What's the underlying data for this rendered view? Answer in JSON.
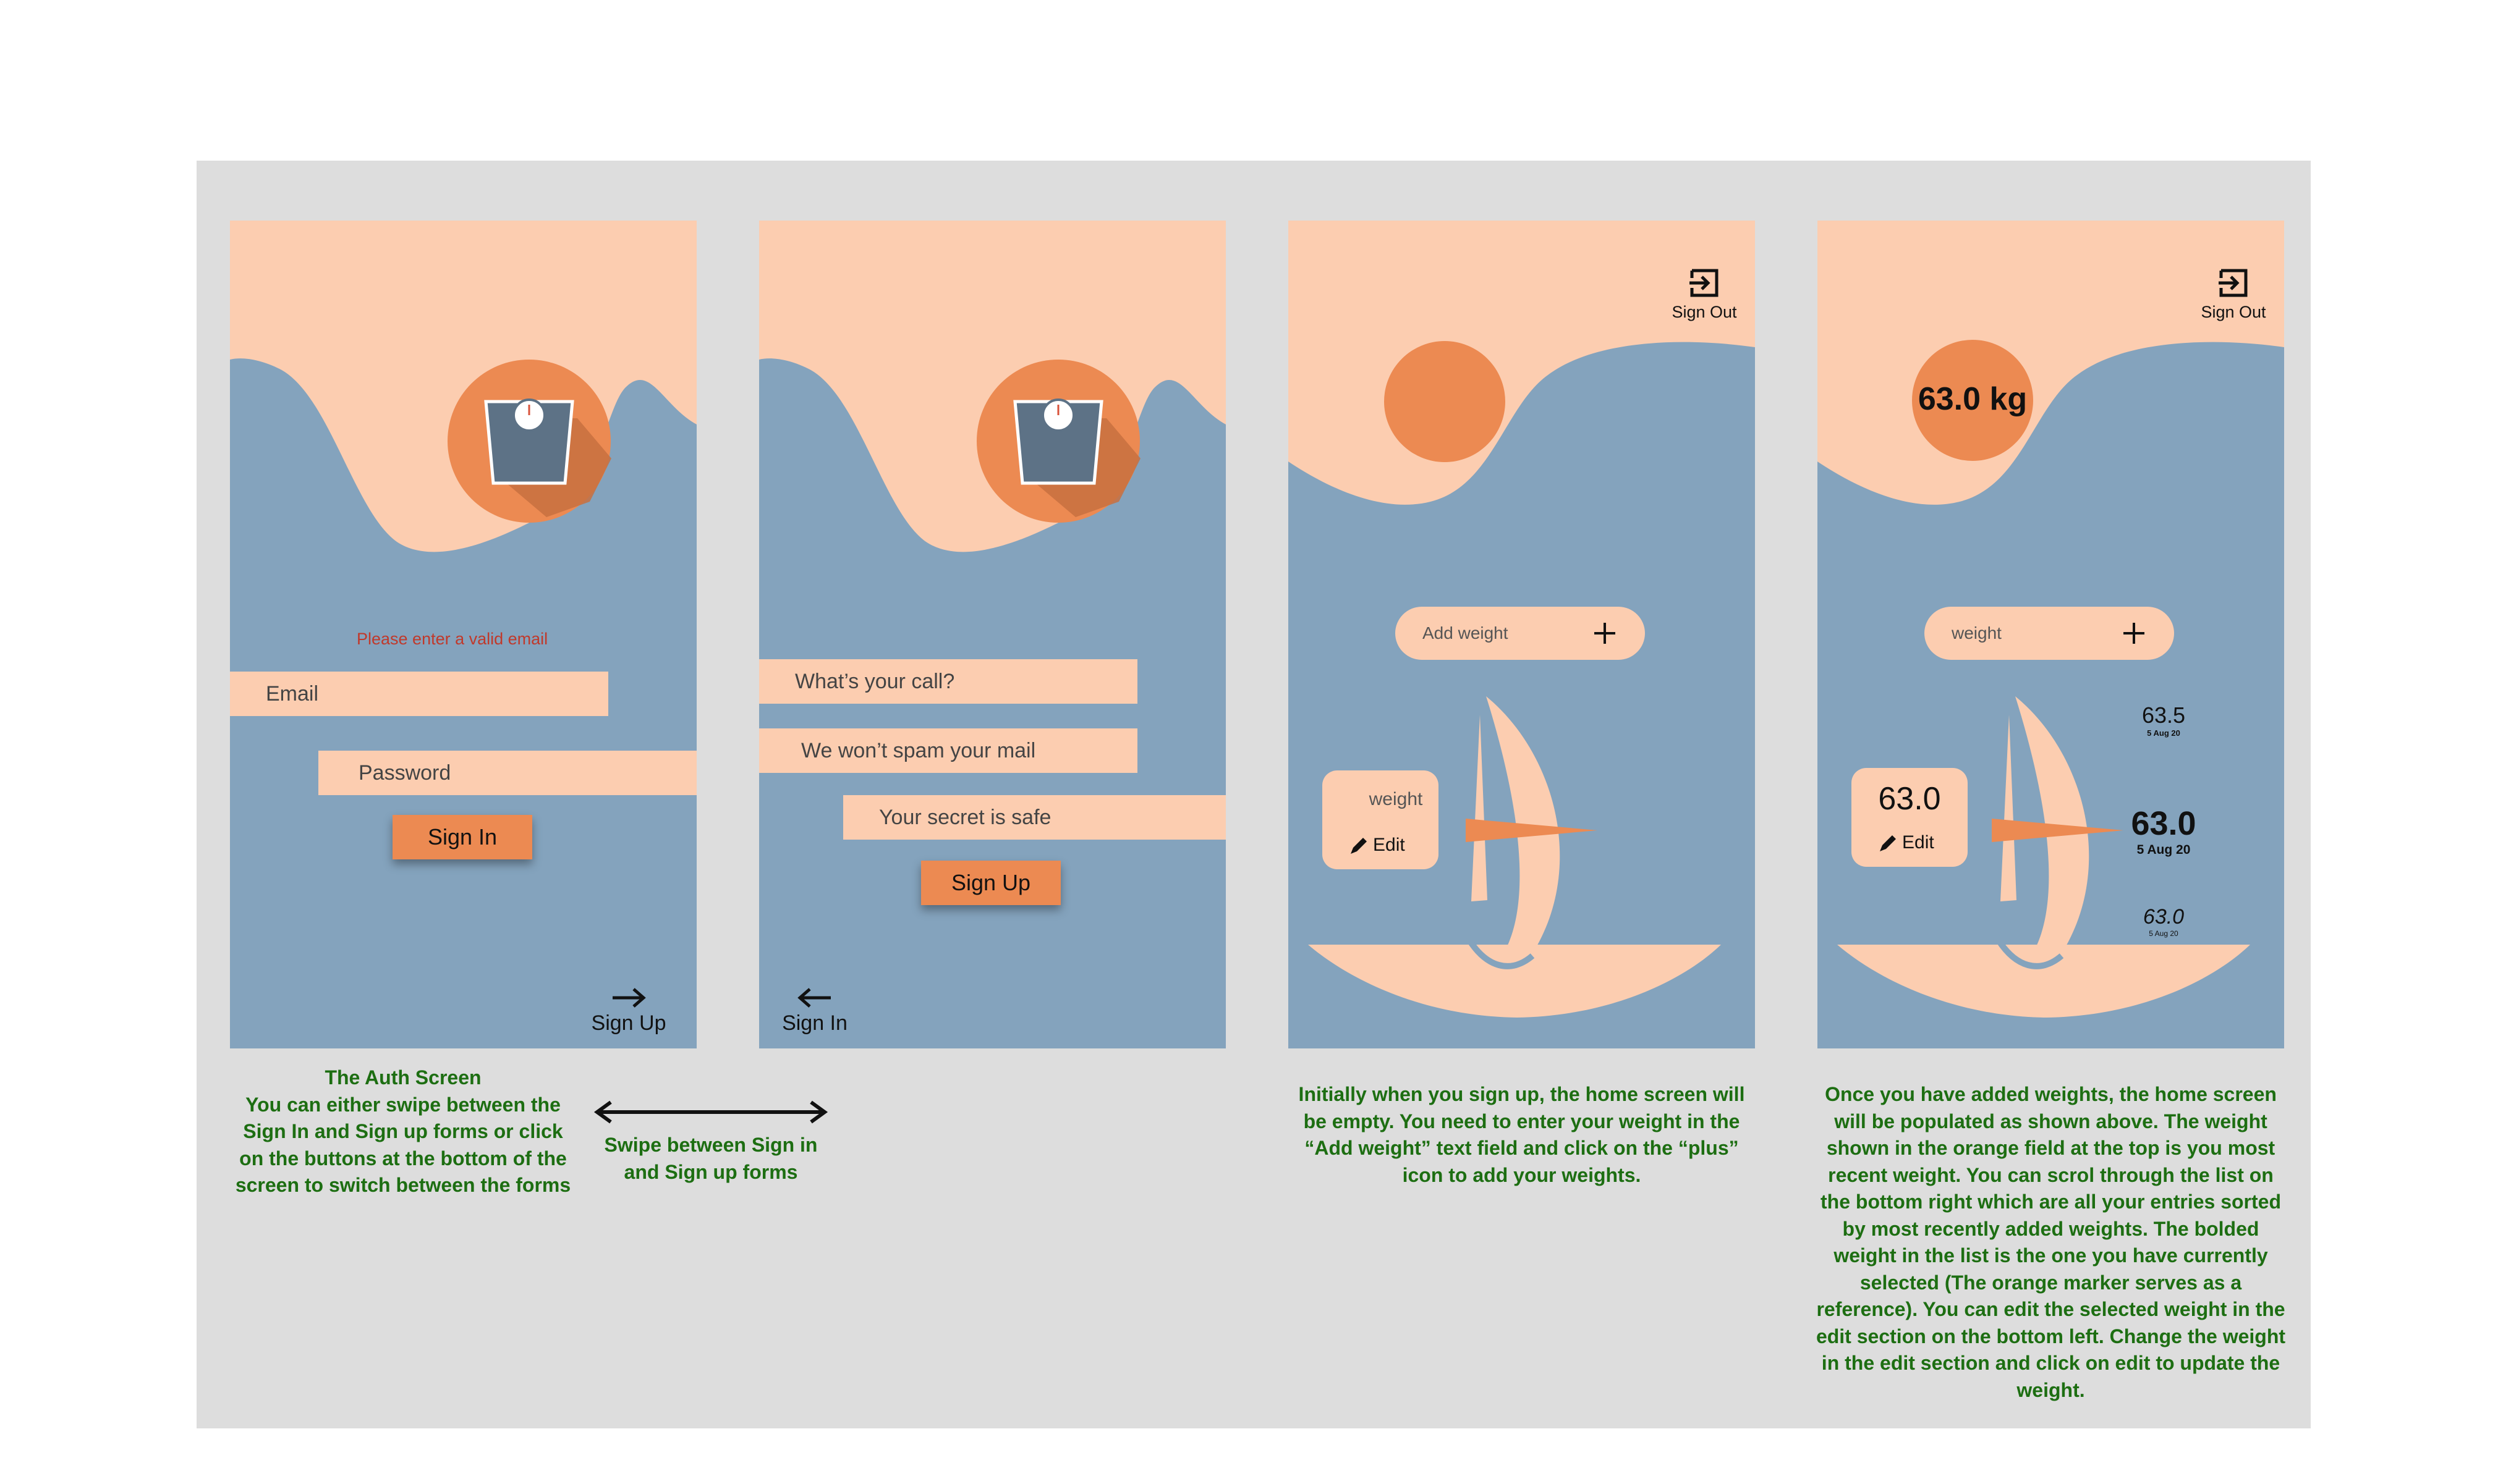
{
  "colors": {
    "peach": "#fccdb0",
    "blue": "#84a3bd",
    "orange": "#ec8a52",
    "caption_green": "#1d6e12",
    "error_red": "#c0392b"
  },
  "screen1": {
    "error_text": "Please enter a valid email",
    "email_placeholder": "Email",
    "password_placeholder": "Password",
    "submit_label": "Sign In",
    "nav_label": "Sign Up",
    "nav_icon": "arrow-right-icon"
  },
  "screen2": {
    "name_placeholder": "What’s your call?",
    "email_placeholder": "We won’t spam your mail",
    "password_placeholder": "Your secret is safe",
    "submit_label": "Sign Up",
    "nav_label": "Sign In",
    "nav_icon": "arrow-left-icon"
  },
  "screen3": {
    "signout_label": "Sign Out",
    "add_placeholder": "Add weight",
    "edit_placeholder": "weight",
    "edit_label": "Edit"
  },
  "screen4": {
    "signout_label": "Sign Out",
    "current_weight": "63.0 kg",
    "add_placeholder": "weight",
    "edit_value": "63.0",
    "edit_label": "Edit",
    "entries": [
      {
        "weight": "63.5",
        "date": "5 Aug 20"
      },
      {
        "weight": "63.0",
        "date": "5 Aug 20"
      },
      {
        "weight": "63.0",
        "date": "5 Aug 20"
      }
    ]
  },
  "captions": {
    "auth": "The Auth Screen\nYou can either swipe between the Sign In and Sign up forms or click on the buttons at the bottom of the screen to switch between the forms",
    "swipe": "Swipe between Sign in and Sign up forms",
    "home_empty": "Initially when you sign up, the home screen will be  empty. You need to enter your weight in the “Add weight” text field and click on the “plus” icon to add your weights.",
    "home_full": "Once you have added weights, the home screen will be populated as shown above. The weight shown in the orange field at the top is you most recent weight. You can scrol through the list on the bottom right which are all your entries sorted by most recently added weights. The bolded weight in the list is the one you have currently selected (The orange marker serves as a reference). You can edit the selected weight in the edit section on the bottom left. Change the weight in the edit section and click on edit to update the weight."
  }
}
